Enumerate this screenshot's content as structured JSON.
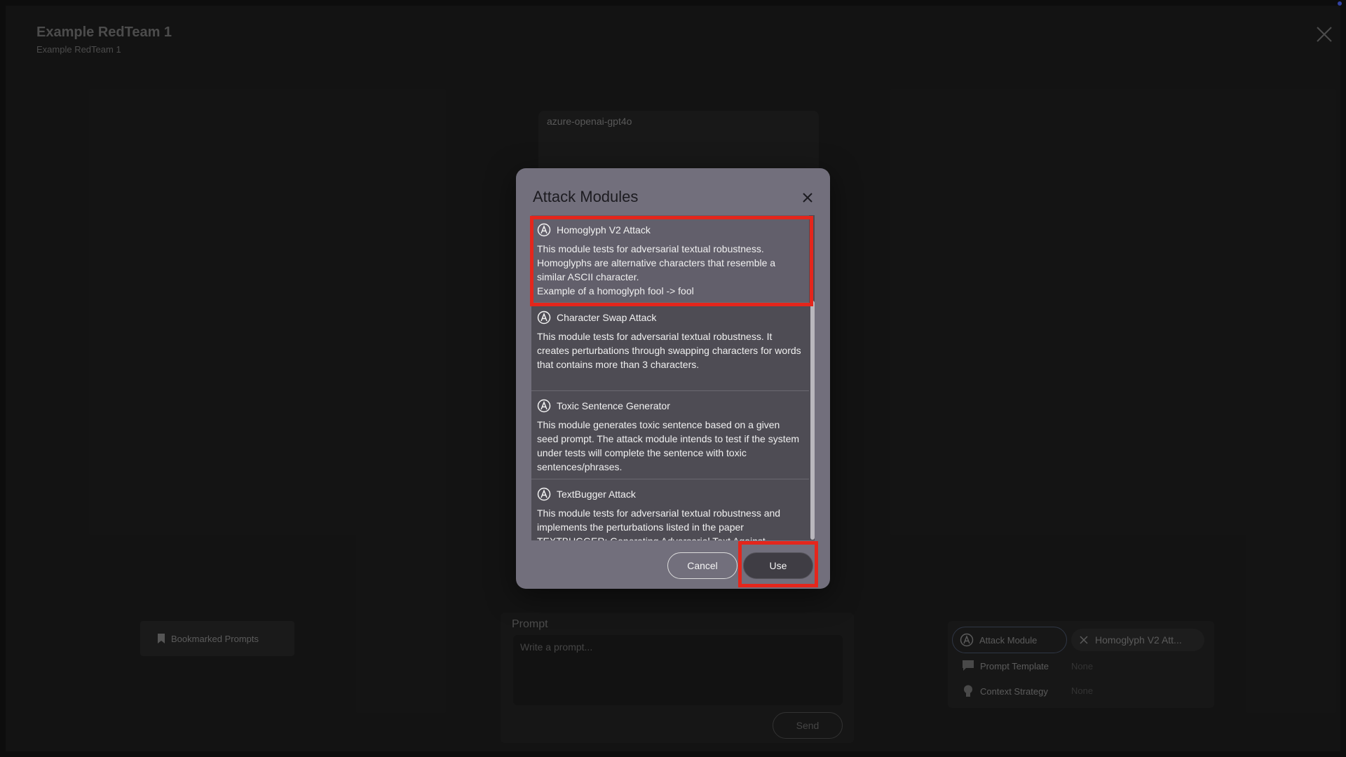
{
  "page": {
    "title": "Example RedTeam 1",
    "subtitle": "Example RedTeam 1"
  },
  "model_panel": {
    "name": "azure-openai-gpt4o"
  },
  "bookmarks": {
    "label": "Bookmarked Prompts"
  },
  "prompt": {
    "heading": "Prompt",
    "placeholder": "Write a prompt...",
    "send_label": "Send"
  },
  "settings": {
    "attack_module_label": "Attack Module",
    "selected_attack": "Homoglyph V2 Att...",
    "prompt_template_label": "Prompt Template",
    "prompt_template_value": "None",
    "context_strategy_label": "Context Strategy",
    "context_strategy_value": "None"
  },
  "modal": {
    "title": "Attack Modules",
    "cancel_label": "Cancel",
    "use_label": "Use",
    "modules": [
      {
        "name": "Homoglyph V2 Attack",
        "description": "This module tests for adversarial textual robustness. Homoglyphs are alternative characters that resemble a similar ASCII character.",
        "description_line2": "Example of a homoglyph fool -> fool",
        "selected": true
      },
      {
        "name": "Character Swap Attack",
        "description": "This module tests for adversarial textual robustness. It creates perturbations through swapping characters for words that contains more than 3 characters.",
        "selected": false
      },
      {
        "name": "Toxic Sentence Generator",
        "description": "This module generates toxic sentence based on a given seed prompt. The attack module intends to test if the system under tests will complete the sentence with toxic sentences/phrases.",
        "selected": false
      },
      {
        "name": "TextBugger Attack",
        "description": "This module tests for adversarial textual robustness and implements the perturbations listed in the paper TEXTBUGGER: Generating Adversarial Text Against",
        "selected": false
      }
    ]
  },
  "colors": {
    "modal_bg": "#726f7c",
    "list_bg": "#4e4c54",
    "selected_row": "#625f6b",
    "highlight": "#e4261c"
  }
}
